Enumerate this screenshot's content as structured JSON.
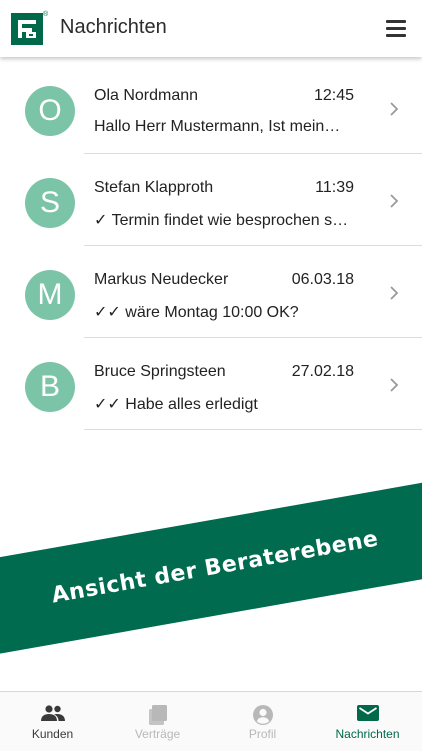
{
  "header": {
    "title": "Nachrichten",
    "logo_icon": "company-logo-icon",
    "logo_mark": "®",
    "menu_icon": "hamburger-menu-icon"
  },
  "messages": [
    {
      "initial": "O",
      "name": "Ola Nordmann",
      "time": "12:45",
      "preview": "Hallo Herr Mustermann, Ist meine Anfrage angekommen?"
    },
    {
      "initial": "S",
      "name": "Stefan Klapproth",
      "time": "11:39",
      "preview": "✓ Termin findet wie besprochen statt"
    },
    {
      "initial": "M",
      "name": "Markus Neudecker",
      "time": "06.03.18",
      "preview": "✓✓ wäre Montag 10:00 OK?"
    },
    {
      "initial": "B",
      "name": "Bruce Springsteen",
      "time": "27.02.18",
      "preview": "✓✓ Habe alles erledigt"
    }
  ],
  "banner": {
    "text": "Ansicht der Beraterebene"
  },
  "nav": {
    "items": [
      {
        "label": "Kunden",
        "icon": "people-icon",
        "state": "enabled"
      },
      {
        "label": "Verträge",
        "icon": "documents-icon",
        "state": "disabled"
      },
      {
        "label": "Profil",
        "icon": "profile-icon",
        "state": "disabled"
      },
      {
        "label": "Nachrichten",
        "icon": "mail-icon",
        "state": "active"
      }
    ]
  },
  "colors": {
    "brand_green": "#006b4e",
    "avatar_green": "#7cc4a8",
    "active_nav": "#00694a",
    "disabled_nav": "#b8b8b8"
  }
}
